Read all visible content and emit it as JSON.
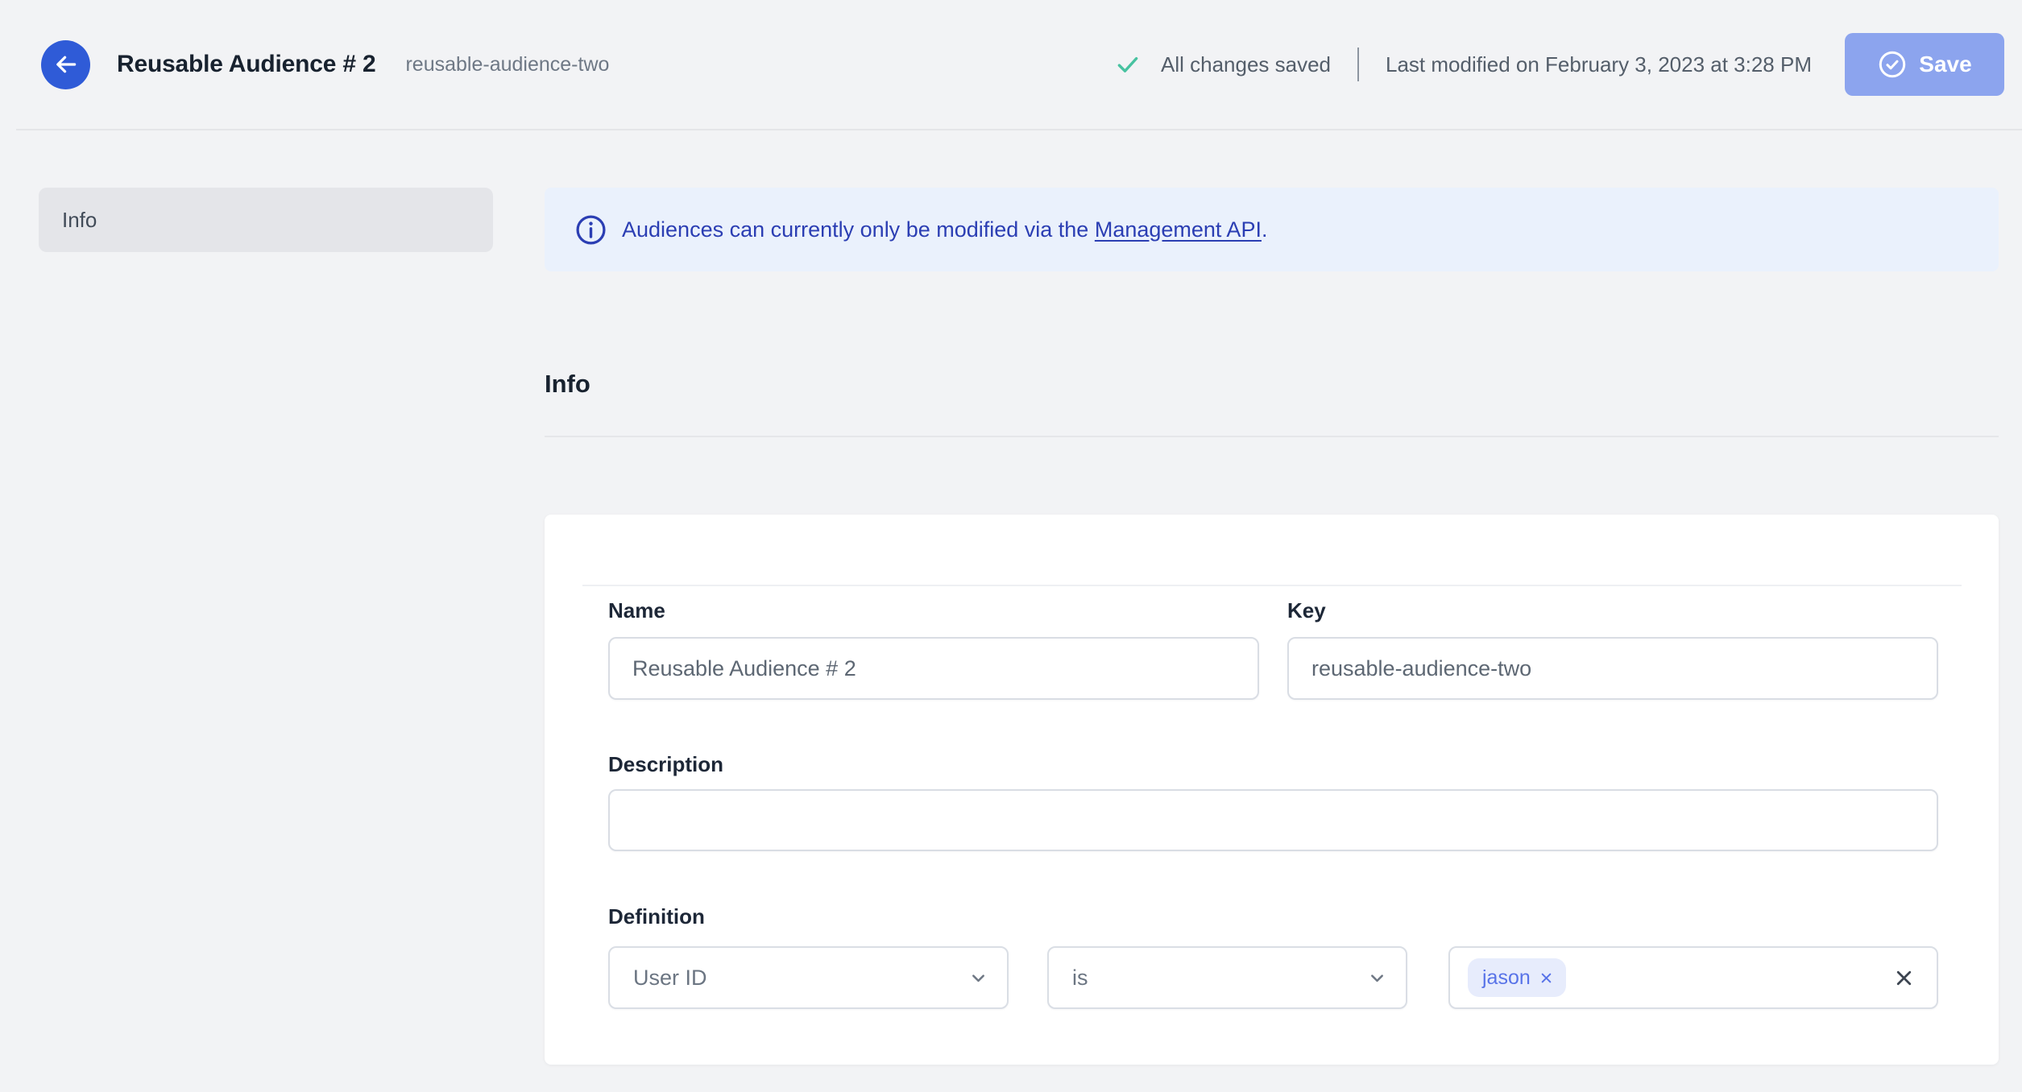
{
  "colors": {
    "accent_blue": "#2f5bd7",
    "banner_text_blue": "#2b3eb3",
    "banner_bg": "#eaf1fc",
    "save_button_bg": "#8ca4ee",
    "success_green": "#47c2a0",
    "tag_bg": "#e7ecfc",
    "tag_text": "#5873e8",
    "page_bg": "#f2f3f5",
    "card_bg": "#ffffff"
  },
  "header": {
    "title": "Reusable Audience # 2",
    "slug": "reusable-audience-two",
    "save_status": "All changes saved",
    "last_modified": "Last modified on February 3, 2023 at 3:28 PM",
    "save_button": "Save"
  },
  "sidebar": {
    "items": [
      {
        "label": "Info",
        "active": true
      }
    ]
  },
  "banner": {
    "message_prefix": "Audiences can currently only be modified via the ",
    "link_label": "Management API",
    "message_suffix": "."
  },
  "main": {
    "section_heading": "Info",
    "form": {
      "name_label": "Name",
      "name_value": "Reusable Audience # 2",
      "key_label": "Key",
      "key_value": "reusable-audience-two",
      "description_label": "Description",
      "description_value": "",
      "definition_label": "Definition",
      "trait_selected": "User ID",
      "operator_selected": "is",
      "tag": "jason"
    }
  }
}
